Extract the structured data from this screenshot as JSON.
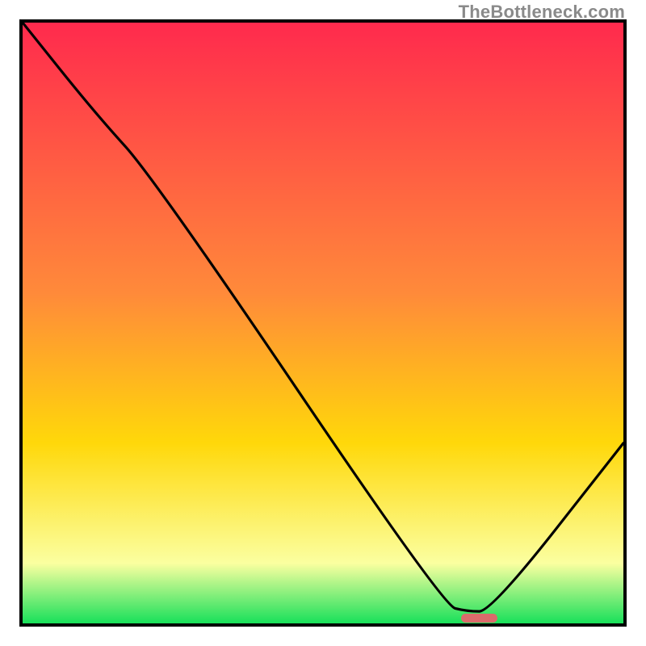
{
  "watermark": {
    "text": "TheBottleneck.com"
  },
  "colors": {
    "frame": "#000000",
    "marker": "#db6b6b",
    "gradient_top": "#ff2a4d",
    "gradient_mid1": "#ff8a3a",
    "gradient_mid2": "#ffd80a",
    "gradient_mid3": "#fbffa0",
    "gradient_bottom": "#18e05a"
  },
  "chart_data": {
    "type": "line",
    "title": "",
    "xlabel": "",
    "ylabel": "",
    "xlim": [
      0,
      100
    ],
    "ylim": [
      0,
      100
    ],
    "series": [
      {
        "name": "bottleneck-curve",
        "x": [
          0,
          12,
          22,
          70,
          74,
          78,
          100
        ],
        "y": [
          100,
          85,
          74,
          3,
          2,
          2,
          30
        ]
      }
    ],
    "annotations": [
      {
        "name": "optimal-range-marker",
        "x_start": 73,
        "x_end": 79,
        "y": 1
      }
    ],
    "background_gradient": {
      "direction": "vertical",
      "stops": [
        {
          "pos": 0,
          "color": "#ff2a4d"
        },
        {
          "pos": 45,
          "color": "#ff8a3a"
        },
        {
          "pos": 70,
          "color": "#ffd80a"
        },
        {
          "pos": 90,
          "color": "#fbffa0"
        },
        {
          "pos": 100,
          "color": "#18e05a"
        }
      ]
    }
  }
}
